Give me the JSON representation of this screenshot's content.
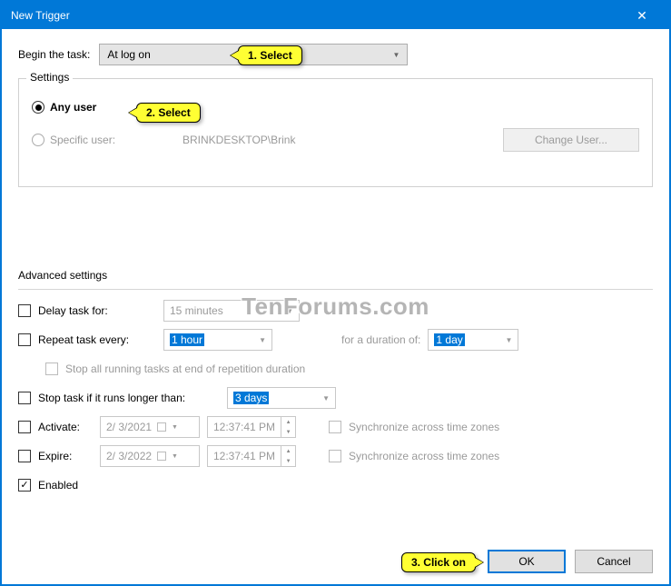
{
  "title": "New Trigger",
  "begin_label": "Begin the task:",
  "begin_value": "At log on",
  "settings": {
    "legend": "Settings",
    "any_user": "Any user",
    "specific_user": "Specific user:",
    "specific_user_value": "BRINKDESKTOP\\Brink",
    "change_user": "Change User..."
  },
  "advanced": {
    "legend": "Advanced settings",
    "delay": "Delay task for:",
    "delay_value": "15 minutes",
    "repeat": "Repeat task every:",
    "repeat_value": "1 hour",
    "duration_label": "for a duration of:",
    "duration_value": "1 day",
    "stop_all": "Stop all running tasks at end of repetition duration",
    "stop_longer": "Stop task if it runs longer than:",
    "stop_longer_value": "3 days",
    "activate": "Activate:",
    "activate_date": "2/ 3/2021",
    "activate_time": "12:37:41 PM",
    "expire": "Expire:",
    "expire_date": "2/ 3/2022",
    "expire_time": "12:37:41 PM",
    "sync": "Synchronize across time zones",
    "enabled": "Enabled"
  },
  "buttons": {
    "ok": "OK",
    "cancel": "Cancel"
  },
  "callouts": {
    "c1": "1. Select",
    "c2": "2. Select",
    "c3": "3. Click on"
  },
  "watermark": "TenForums.com"
}
